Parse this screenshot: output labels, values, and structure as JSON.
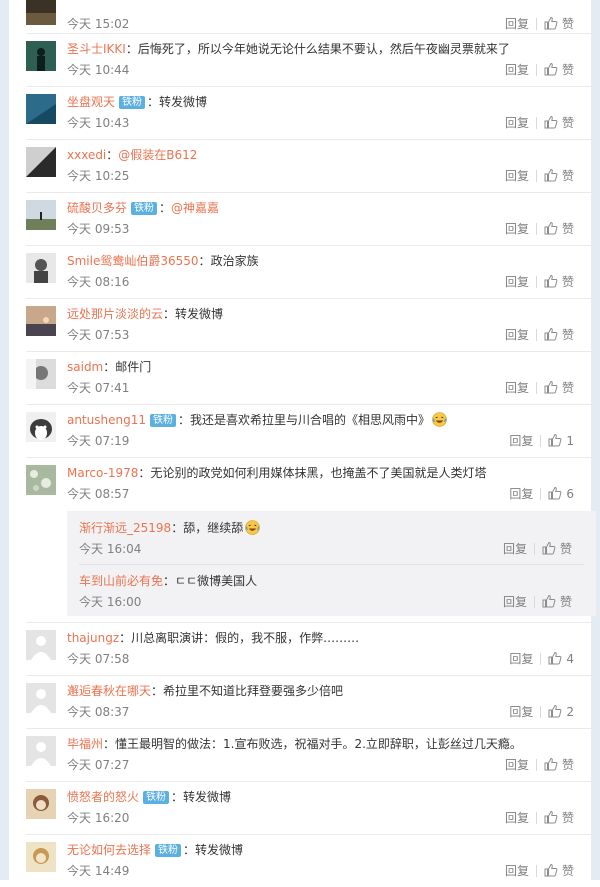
{
  "actions": {
    "reply": "回复",
    "like": "赞"
  },
  "comments": [
    {
      "user": "",
      "badge": "",
      "text": "",
      "time": "今天 15:02",
      "likes": "赞",
      "avatar": "dark"
    },
    {
      "user": "圣斗士IKKI",
      "badge": "",
      "text": "后悔死了，所以今年她说无论什么结果不要认，然后午夜幽灵票就来了",
      "time": "今天 10:44",
      "likes": "赞",
      "avatar": "silhouette"
    },
    {
      "user": "坐盘观天",
      "badge": "铁粉",
      "text": "转发微博",
      "time": "今天 10:43",
      "likes": "赞",
      "avatar": "sea"
    },
    {
      "user": "xxxedi",
      "badge": "",
      "mention": "@假装在B612",
      "text": "",
      "time": "今天 10:25",
      "likes": "赞",
      "avatar": "mono"
    },
    {
      "user": "硫酸贝多芬",
      "badge": "铁粉",
      "mention": "@神嘉嘉",
      "text": "",
      "time": "今天 09:53",
      "likes": "赞",
      "avatar": "field"
    },
    {
      "user": "Smile鸳鸯屾伯爵36550",
      "badge": "",
      "text": "政治家族",
      "time": "今天 08:16",
      "likes": "赞",
      "avatar": "sketch"
    },
    {
      "user": "远处那片淡淡的云",
      "badge": "",
      "text": "转发微博",
      "time": "今天 07:53",
      "likes": "赞",
      "avatar": "sunset"
    },
    {
      "user": "saidm",
      "badge": "",
      "text": "邮件门",
      "time": "今天 07:41",
      "likes": "赞",
      "avatar": "bw"
    },
    {
      "user": "antusheng11",
      "badge": "铁粉",
      "text": "我还是喜欢希拉里与川合唱的《相思风雨中》",
      "emoji": true,
      "time": "今天 07:19",
      "likes": "1",
      "avatar": "husky"
    },
    {
      "user": "Marco-1978",
      "badge": "",
      "text": "无论别的政党如何利用媒体抹黑，也掩盖不了美国就是人类灯塔",
      "time": "今天 08:57",
      "likes": "6",
      "avatar": "rocks",
      "replies": [
        {
          "user": "渐行渐远_25198",
          "text": "舔，继续舔",
          "emoji": true,
          "time": "今天 16:04",
          "likes": "赞"
        },
        {
          "user": "车到山前必有免",
          "text": "ㄷㄷ微博美国人",
          "time": "今天 16:00",
          "likes": "赞"
        }
      ]
    },
    {
      "user": "thajungz",
      "badge": "",
      "text": "川总离职演讲：假的，我不服，作弊………",
      "time": "今天 07:58",
      "likes": "4",
      "avatar": "default"
    },
    {
      "user": "邂逅春秋在哪天",
      "badge": "",
      "text": "希拉里不知道比拜登要强多少倍吧",
      "time": "今天 08:37",
      "likes": "2",
      "avatar": "default"
    },
    {
      "user": "毕福州",
      "badge": "",
      "text": "懂王最明智的做法：1.宣布败选，祝福对手。2.立即辞职，让彭丝过几天瘾。",
      "time": "今天 07:27",
      "likes": "赞",
      "avatar": "default"
    },
    {
      "user": "愤怒者的怒火",
      "badge": "铁粉",
      "text": "转发微博",
      "time": "今天 16:20",
      "likes": "赞",
      "avatar": "girl"
    },
    {
      "user": "无论如何去选择",
      "badge": "铁粉",
      "text": "转发微博",
      "time": "今天 14:49",
      "likes": "赞",
      "avatar": "girl2"
    }
  ]
}
